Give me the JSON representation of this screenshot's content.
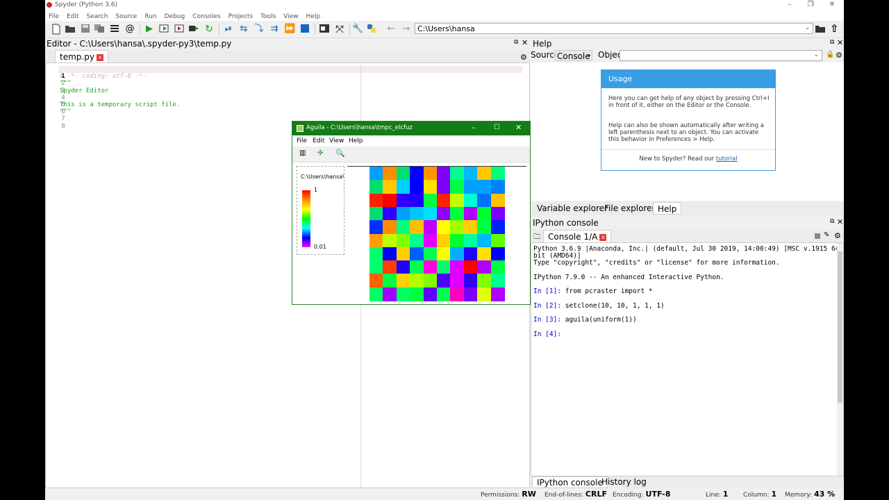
{
  "window": {
    "title": "Spyder (Python 3.6)",
    "controls": [
      "–",
      "❐",
      "✕"
    ]
  },
  "menu": [
    "File",
    "Edit",
    "Search",
    "Source",
    "Run",
    "Debug",
    "Consoles",
    "Projects",
    "Tools",
    "View",
    "Help"
  ],
  "toolbar": {
    "path": "C:\\Users\\hansa"
  },
  "editor": {
    "header": "Editor - C:\\Users\\hansa\\.spyder-py3\\temp.py",
    "tab": "temp.py",
    "line_numbers": [
      "1",
      "2",
      "3",
      "4",
      "5",
      "6",
      "7",
      "8"
    ],
    "lines": [
      "# -*- coding: utf-8 -*-",
      "\"\"\"",
      "Spyder Editor",
      "",
      "This is a temporary script file.",
      "\"\"\"",
      "",
      ""
    ]
  },
  "help": {
    "header": "Help",
    "source_label": "Source",
    "source_value": "Console",
    "object_label": "Object",
    "usage_title": "Usage",
    "p1": "Here you can get help of any object by pressing Ctrl+I in front of it, either on the Editor or the Console.",
    "p2": "Help can also be shown automatically after writing a left parenthesis next to an object. You can activate this behavior in Preferences > Help.",
    "new_text": "New to Spyder? Read our ",
    "tutorial_link": "tutorial",
    "tabs": [
      "Variable explorer",
      "File explorer",
      "Help"
    ]
  },
  "ipython": {
    "header": "IPython console",
    "tab": "Console 1/A",
    "lines": [
      "Python 3.6.9 |Anaconda, Inc.| (default, Jul 30 2019, 14:00:49) [MSC v.1915 64",
      "bit (AMD64)]",
      "Type \"copyright\", \"credits\" or \"license\" for more information.",
      "",
      "IPython 7.9.0 -- An enhanced Interactive Python."
    ],
    "in1_prompt": "In [1]:",
    "in1_code": "from pcraster import *",
    "in2_prompt": "In [2]:",
    "in2_code": "setclone(10, 10, 1, 1, 1)",
    "in3_prompt": "In [3]:",
    "in3_code": "aguila(uniform(1))",
    "in4_prompt": "In [4]:",
    "tabs": [
      "IPython console",
      "History log"
    ]
  },
  "status": {
    "permissions_label": "Permissions:",
    "permissions": "RW",
    "eol_label": "End-of-lines:",
    "eol": "CRLF",
    "encoding_label": "Encoding:",
    "encoding": "UTF-8",
    "line_label": "Line:",
    "line": "1",
    "column_label": "Column:",
    "column": "1",
    "memory_label": "Memory:",
    "memory": "43 %"
  },
  "aguila": {
    "title": "Aguila - C:\\Users\\hansa\\tmpc_elcfuz",
    "menu": [
      "File",
      "Edit",
      "View",
      "Help"
    ],
    "legend_path": "C:\\Users\\hansa\\t",
    "legend_max": "1",
    "legend_min": "0.01",
    "grid_colors": [
      [
        "#00a0ff",
        "#ff8c00",
        "#00e070",
        "#0000ff",
        "#ff9600",
        "#8000ff",
        "#00ff90",
        "#00b8ff",
        "#ffc800",
        "#00ff80"
      ],
      [
        "#00e070",
        "#ffc800",
        "#00d0ff",
        "#0000ff",
        "#ffe000",
        "#8000ff",
        "#00ff40",
        "#00a0ff",
        "#00a0ff",
        "#0080ff"
      ],
      [
        "#ff2000",
        "#ff0000",
        "#3000ff",
        "#2000ff",
        "#00ff40",
        "#ff2000",
        "#c0ff00",
        "#00ffd0",
        "#0070ff",
        "#ffc000"
      ],
      [
        "#00e070",
        "#3000ff",
        "#00a0ff",
        "#00c8ff",
        "#00e0ff",
        "#9000ff",
        "#00ff40",
        "#b000ff",
        "#00ff30",
        "#8000ff"
      ],
      [
        "#0030ff",
        "#ff8c00",
        "#00ff80",
        "#ffc000",
        "#c000ff",
        "#ffff00",
        "#a0ff00",
        "#ffd000",
        "#00ff40",
        "#0020ff"
      ],
      [
        "#ffa000",
        "#c0ff00",
        "#80ff00",
        "#00ff90",
        "#e000ff",
        "#ffd000",
        "#00ff30",
        "#00ffa0",
        "#00b8ff",
        "#60ff00"
      ],
      [
        "#00ff70",
        "#0000ff",
        "#ffd000",
        "#0060ff",
        "#00ff50",
        "#ffff00",
        "#00b0ff",
        "#2000ff",
        "#ffe000",
        "#0000ff"
      ],
      [
        "#00ff70",
        "#ff4000",
        "#2000ff",
        "#00ff50",
        "#ff00e0",
        "#00ff70",
        "#e000ff",
        "#ff0000",
        "#b000ff",
        "#00ff40"
      ],
      [
        "#ff6000",
        "#00ff40",
        "#ffd000",
        "#b0ff00",
        "#80ff00",
        "#5000ff",
        "#e000ff",
        "#3000ff",
        "#80ff00",
        "#00ff90"
      ],
      [
        "#00ff60",
        "#a000ff",
        "#00ff60",
        "#00ff40",
        "#6000ff",
        "#00ff50",
        "#ff00c0",
        "#8000ff",
        "#e0ff00",
        "#b000ff"
      ]
    ]
  }
}
